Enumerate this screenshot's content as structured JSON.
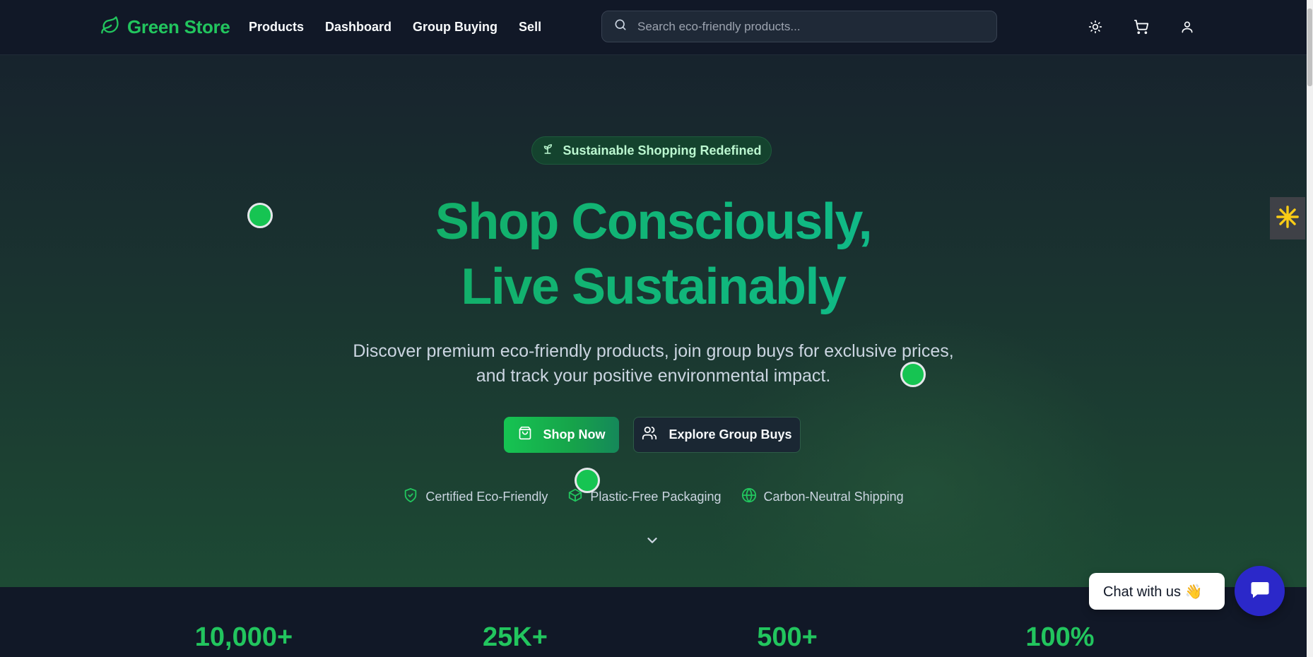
{
  "nav": {
    "brand": "Green Store",
    "links": [
      "Products",
      "Dashboard",
      "Group Buying",
      "Sell"
    ],
    "search_placeholder": "Search eco-friendly products..."
  },
  "hero": {
    "badge": "Sustainable Shopping Redefined",
    "headline_line1": "Shop Consciously,",
    "headline_line2": "Live Sustainably",
    "subtitle_line1": "Discover premium eco-friendly products, join group buys for exclusive prices,",
    "subtitle_line2": "and track your positive environmental impact.",
    "primary_button": "Shop Now",
    "secondary_button": "Explore Group Buys",
    "features": [
      "Certified Eco-Friendly",
      "Plastic-Free Packaging",
      "Carbon-Neutral Shipping"
    ]
  },
  "stats": [
    "10,000+",
    "25K+",
    "500+",
    "100%"
  ],
  "chat": {
    "prompt": "Chat with us 👋"
  },
  "colors": {
    "accent": "#22c55e",
    "header_bg": "#111827",
    "chat_button": "#2b28c9"
  },
  "icons": {
    "logo": "leaf-icon",
    "theme": "sun-icon",
    "cart": "cart-icon",
    "account": "user-icon",
    "badge": "sprout-icon",
    "shop": "shopping-bag-icon",
    "group": "users-icon",
    "feature1": "shield-check-icon",
    "feature2": "package-icon",
    "feature3": "globe-icon",
    "scroll": "chevron-down-icon",
    "chat": "message-icon"
  }
}
